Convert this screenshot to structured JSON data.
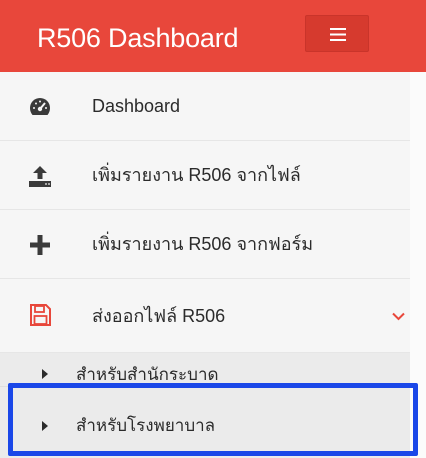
{
  "header": {
    "brand": "R506 Dashboard",
    "menu_toggle_icon": "hamburger-icon",
    "background_color": "#e8473b"
  },
  "sidebar": {
    "items": [
      {
        "label": "Dashboard",
        "icon": "tachometer-icon"
      },
      {
        "label": "เพิ่มรายงาน R506 จากไฟล์",
        "icon": "upload-icon"
      },
      {
        "label": "เพิ่มรายงาน R506 จากฟอร์ม",
        "icon": "plus-icon"
      },
      {
        "label": "ส่งออกไฟล์ R506",
        "icon": "save-icon",
        "expanded": true,
        "chevron_icon": "chevron-down-icon"
      }
    ],
    "submenu": [
      {
        "label": "สำหรับสำนักระบาด",
        "icon": "caret-right-icon"
      },
      {
        "label": "สำหรับโรงพยาบาล",
        "icon": "caret-right-icon",
        "highlighted": true
      }
    ]
  },
  "colors": {
    "accent": "#e8473b",
    "highlight_border": "#1a47e8",
    "sidebar_bg": "#f6f6f6",
    "submenu_bg": "#ebebeb"
  }
}
